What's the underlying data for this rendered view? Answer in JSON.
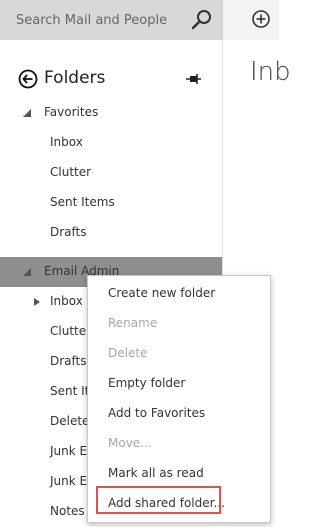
{
  "search": {
    "placeholder": "Search Mail and People"
  },
  "toolbar": {
    "new_icon": "plus-circle-icon"
  },
  "content": {
    "title": "Inb"
  },
  "folders": {
    "title": "Folders",
    "favorites_label": "Favorites",
    "favorites": [
      "Inbox",
      "Clutter",
      "Sent Items",
      "Drafts"
    ],
    "account_label": "Email Admin",
    "account_items": [
      "Inbox",
      "Clutter",
      "Drafts",
      "Sent Ite",
      "Delete",
      "Junk E",
      "Junk E",
      "Notes"
    ]
  },
  "context_menu": {
    "items": [
      {
        "label": "Create new folder",
        "enabled": true
      },
      {
        "label": "Rename",
        "enabled": false
      },
      {
        "label": "Delete",
        "enabled": false
      },
      {
        "label": "Empty folder",
        "enabled": true
      },
      {
        "label": "Add to Favorites",
        "enabled": true
      },
      {
        "label": "Move...",
        "enabled": false
      },
      {
        "label": "Mark all as read",
        "enabled": true
      },
      {
        "label": "Add shared folder...",
        "enabled": true
      }
    ],
    "highlighted": "Add shared folder...",
    "highlight_color": "#d9534f"
  },
  "colors": {
    "search_bg": "#d8d8d8",
    "selected_row_bg": "#8f8f8f",
    "disabled_text": "#a8a8a8"
  }
}
